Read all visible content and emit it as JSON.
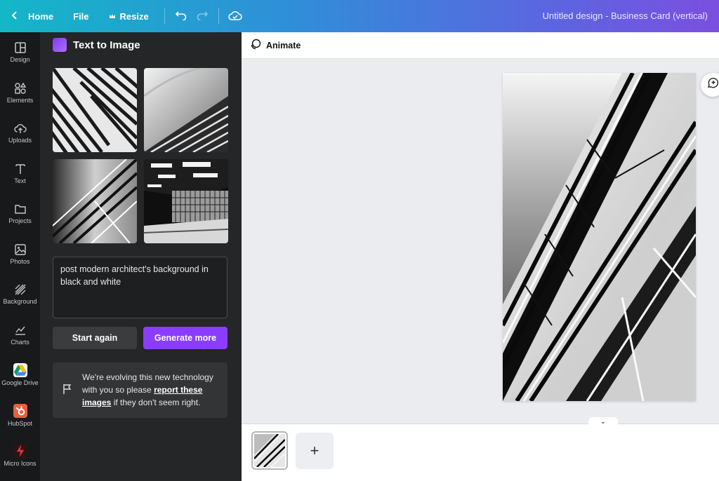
{
  "topbar": {
    "home_label": "Home",
    "file_label": "File",
    "resize_label": "Resize",
    "design_title": "Untitled design - Business Card (vertical)"
  },
  "rail": {
    "items": [
      {
        "label": "Design",
        "icon": "design-icon"
      },
      {
        "label": "Elements",
        "icon": "elements-icon"
      },
      {
        "label": "Uploads",
        "icon": "upload-cloud-icon"
      },
      {
        "label": "Text",
        "icon": "text-icon"
      },
      {
        "label": "Projects",
        "icon": "folder-icon"
      },
      {
        "label": "Photos",
        "icon": "photo-icon"
      },
      {
        "label": "Background",
        "icon": "background-icon"
      },
      {
        "label": "Charts",
        "icon": "chart-icon"
      },
      {
        "label": "Google Drive",
        "icon": "google-drive-icon"
      },
      {
        "label": "HubSpot",
        "icon": "hubspot-icon"
      },
      {
        "label": "Micro Icons",
        "icon": "micro-icons-icon"
      }
    ]
  },
  "panel": {
    "title": "Text to Image",
    "prompt": "post modern architect's background in black and white",
    "start_again_label": "Start again",
    "generate_more_label": "Generate more",
    "notice_prefix": "We're evolving this new technology with you so please ",
    "notice_link": "report these images",
    "notice_suffix": " if they don't seem right."
  },
  "toolbar": {
    "animate_label": "Animate"
  },
  "colors": {
    "accent": "#8b3dff",
    "panel_bg": "#252627",
    "rail_bg": "#18191b"
  }
}
